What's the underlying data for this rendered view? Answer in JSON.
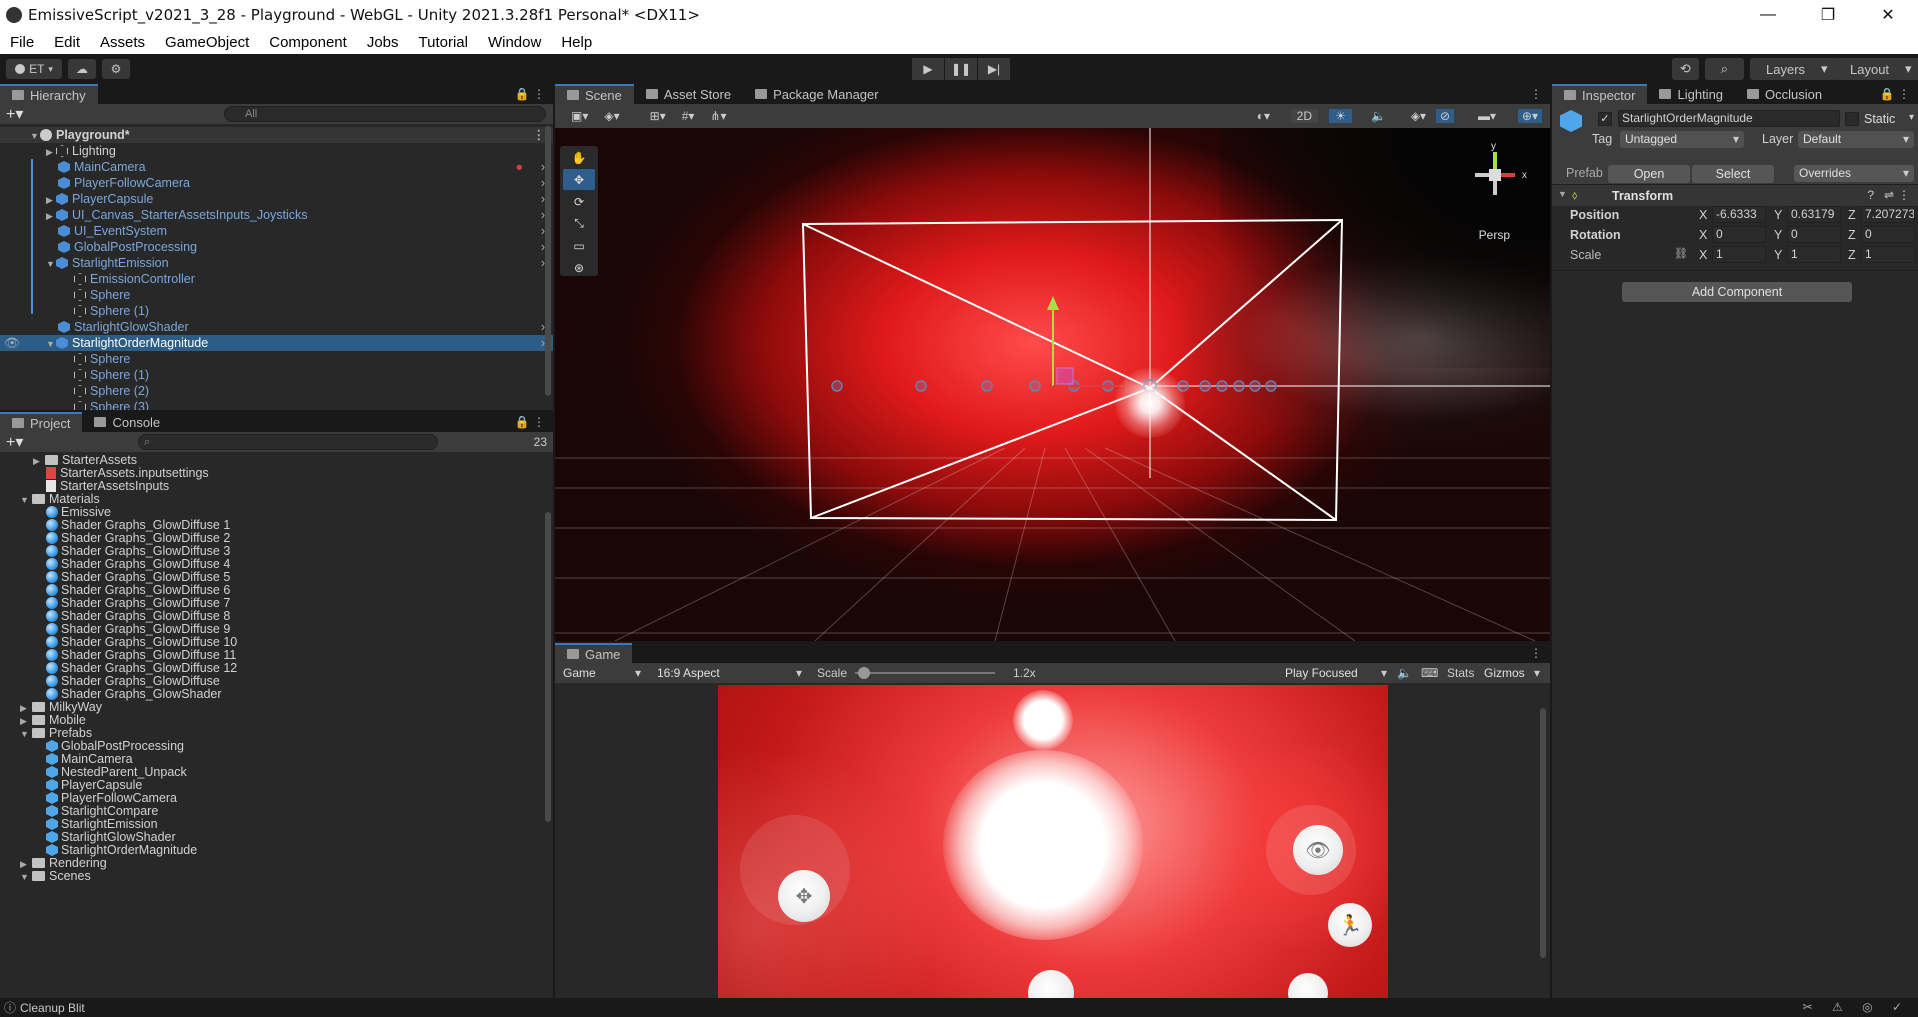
{
  "window": {
    "title": "EmissiveScript_v2021_3_28 - Playground - WebGL - Unity 2021.3.28f1 Personal* <DX11>",
    "minimize": "—",
    "restore": "❐",
    "close": "✕"
  },
  "menu": [
    "File",
    "Edit",
    "Assets",
    "GameObject",
    "Component",
    "Jobs",
    "Tutorial",
    "Window",
    "Help"
  ],
  "toolbar": {
    "account": "ET",
    "layers": "Layers",
    "layout": "Layout"
  },
  "hierarchy": {
    "tab": "Hierarchy",
    "search_placeholder": "All",
    "scene": "Playground*",
    "items": [
      {
        "label": "Lighting"
      },
      {
        "label": "MainCamera"
      },
      {
        "label": "PlayerFollowCamera"
      },
      {
        "label": "PlayerCapsule"
      },
      {
        "label": "UI_Canvas_StarterAssetsInputs_Joysticks"
      },
      {
        "label": "UI_EventSystem"
      },
      {
        "label": "GlobalPostProcessing"
      },
      {
        "label": "StarlightEmission"
      },
      {
        "label": "EmissionController"
      },
      {
        "label": "Sphere"
      },
      {
        "label": "Sphere (1)"
      },
      {
        "label": "StarlightGlowShader"
      },
      {
        "label": "StarlightOrderMagnitude"
      },
      {
        "label": "Sphere"
      },
      {
        "label": "Sphere (1)"
      },
      {
        "label": "Sphere (2)"
      },
      {
        "label": "Sphere (3)"
      }
    ]
  },
  "project": {
    "tab_project": "Project",
    "tab_console": "Console",
    "hidden_count": "23",
    "items": [
      {
        "label": "StarterAssets"
      },
      {
        "label": "StarterAssets.inputsettings"
      },
      {
        "label": "StarterAssetsInputs"
      },
      {
        "label": "Materials"
      },
      {
        "label": "Emissive"
      },
      {
        "label": "Shader Graphs_GlowDiffuse 1"
      },
      {
        "label": "Shader Graphs_GlowDiffuse 2"
      },
      {
        "label": "Shader Graphs_GlowDiffuse 3"
      },
      {
        "label": "Shader Graphs_GlowDiffuse 4"
      },
      {
        "label": "Shader Graphs_GlowDiffuse 5"
      },
      {
        "label": "Shader Graphs_GlowDiffuse 6"
      },
      {
        "label": "Shader Graphs_GlowDiffuse 7"
      },
      {
        "label": "Shader Graphs_GlowDiffuse 8"
      },
      {
        "label": "Shader Graphs_GlowDiffuse 9"
      },
      {
        "label": "Shader Graphs_GlowDiffuse 10"
      },
      {
        "label": "Shader Graphs_GlowDiffuse 11"
      },
      {
        "label": "Shader Graphs_GlowDiffuse 12"
      },
      {
        "label": "Shader Graphs_GlowDiffuse"
      },
      {
        "label": "Shader Graphs_GlowShader"
      },
      {
        "label": "MilkyWay"
      },
      {
        "label": "Mobile"
      },
      {
        "label": "Prefabs"
      },
      {
        "label": "GlobalPostProcessing"
      },
      {
        "label": "MainCamera"
      },
      {
        "label": "NestedParent_Unpack"
      },
      {
        "label": "PlayerCapsule"
      },
      {
        "label": "PlayerFollowCamera"
      },
      {
        "label": "StarlightCompare"
      },
      {
        "label": "StarlightEmission"
      },
      {
        "label": "StarlightGlowShader"
      },
      {
        "label": "StarlightOrderMagnitude"
      },
      {
        "label": "Rendering"
      },
      {
        "label": "Scenes"
      }
    ]
  },
  "scene": {
    "tabs": [
      "Scene",
      "Asset Store",
      "Package Manager"
    ],
    "btn_2d": "2D",
    "persp": "Persp",
    "axis_y": "y",
    "axis_x": "x"
  },
  "game": {
    "tab": "Game",
    "display": "Game",
    "aspect": "16:9 Aspect",
    "scale_label": "Scale",
    "scale_value": "1.2x",
    "scale_fraction": 0.02,
    "play_mode": "Play Focused",
    "stats": "Stats",
    "gizmos": "Gizmos"
  },
  "inspector": {
    "tabs": [
      "Inspector",
      "Lighting",
      "Occlusion"
    ],
    "object_name": "StarlightOrderMagnitude",
    "static": "Static",
    "tag_label": "Tag",
    "tag_value": "Untagged",
    "layer_label": "Layer",
    "layer_value": "Default",
    "prefab_label": "Prefab",
    "open": "Open",
    "select": "Select",
    "overrides": "Overrides",
    "component": "Transform",
    "position_label": "Position",
    "rotation_label": "Rotation",
    "scale_label": "Scale",
    "position": {
      "x": "-6.6333",
      "y": "0.63179",
      "z": "7.207273"
    },
    "rotation": {
      "x": "0",
      "y": "0",
      "z": "0"
    },
    "scale": {
      "x": "1",
      "y": "1",
      "z": "1"
    },
    "add_component": "Add Component"
  },
  "status": {
    "text": "Cleanup Blit"
  }
}
